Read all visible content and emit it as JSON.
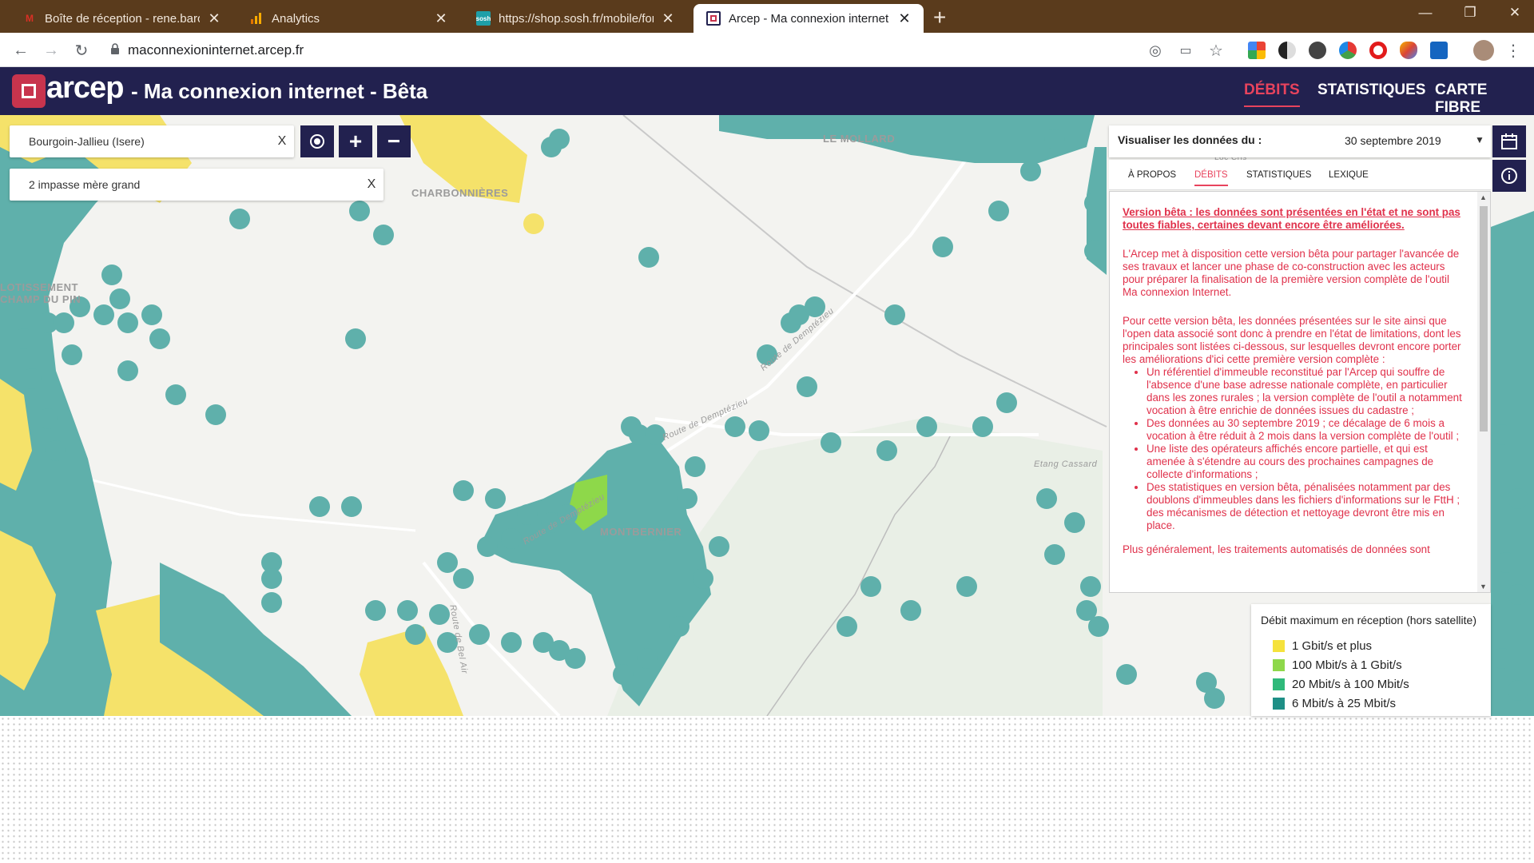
{
  "browser": {
    "tabs": [
      {
        "title": "Boîte de réception - rene.barou",
        "favicon": "gmail-icon",
        "color": "#d93025"
      },
      {
        "title": "Analytics",
        "favicon": "analytics-icon",
        "color": "#f9ab00"
      },
      {
        "title": "https://shop.sosh.fr/mobile/forfa",
        "favicon": "sosh-icon",
        "color": "#1e9fa8"
      },
      {
        "title": "Arcep - Ma connexion internet - ",
        "favicon": "arcep-icon",
        "color": "#22214f"
      }
    ],
    "url": "maconnexioninternet.arcep.fr"
  },
  "site": {
    "logo_text": "arcep",
    "title": "- Ma connexion internet - Bêta",
    "nav": [
      "DÉBITS",
      "STATISTIQUES",
      "CARTE FIBRE"
    ]
  },
  "search": {
    "commune": "Bourgoin-Jallieu (Isere)",
    "address": "2 impasse mère grand",
    "clear_label": "X"
  },
  "map_labels": [
    "LE MOLLARD",
    "CHARBONNIÈRES",
    "LOTISSEMENT",
    "CHAMP DU PIN",
    "MONTBERNIER",
    "Etang Cassard",
    "Route de Demptézieu",
    "Route de Demptézieu",
    "Route de Demptézieu",
    "Loc Cris",
    "Route de Bel Air"
  ],
  "panel": {
    "date_label": "Visualiser les données du :",
    "date_value": "30 septembre 2019",
    "tabs": [
      "À PROPOS",
      "DÉBITS",
      "STATISTIQUES",
      "LEXIQUE"
    ],
    "warning": "Version bêta : les données sont présentées en l'état et ne sont pas toutes fiables, certaines devant encore être améliorées.",
    "para1": "L'Arcep met à disposition cette version bêta pour partager l'avancée de ses travaux et lancer une phase de co-construction avec les acteurs pour préparer la finalisation de la première version complète de l'outil Ma connexion Internet.",
    "para2": "Pour cette version bêta, les données présentées sur le site ainsi que l'open data associé sont donc à prendre en l'état de limitations, dont les principales sont listées ci-dessous, sur lesquelles devront encore porter les améliorations d'ici cette première version complète :",
    "bullets": [
      "Un référentiel d'immeuble reconstitué par l'Arcep qui souffre de l'absence d'une base adresse nationale complète, en particulier dans les zones rurales ; la version complète de l'outil a notamment vocation à être enrichie de données issues du cadastre ;",
      "Des données au 30 septembre 2019 ; ce décalage de 6 mois a vocation à être réduit à 2 mois dans la version complète de l'outil ;",
      "Une liste des opérateurs affichés encore partielle, et qui est amenée à s'étendre au cours des prochaines campagnes de collecte d'informations ;",
      "Des statistiques en version bêta, pénalisées notamment par des doublons d'immeubles dans les fichiers d'informations sur le FttH ; des mécanismes de détection et nettoyage devront être mis en place."
    ],
    "para3": "Plus généralement, les traitements automatisés de données sont"
  },
  "legend": {
    "title": "Débit maximum en réception (hors satellite)",
    "items": [
      {
        "label": "1 Gbit/s et plus",
        "color": "#f5e23c"
      },
      {
        "label": "100 Mbit/s à 1 Gbit/s",
        "color": "#8ed84a"
      },
      {
        "label": "20 Mbit/s à 100 Mbit/s",
        "color": "#2fb97a"
      },
      {
        "label": "6 Mbit/s à 25 Mbit/s",
        "color": "#1e8f86"
      }
    ]
  },
  "colors": {
    "header": "#22214f",
    "accent": "#e8435d",
    "coverage_teal": "#5fb0ab",
    "coverage_yellow": "#f5e26a"
  }
}
